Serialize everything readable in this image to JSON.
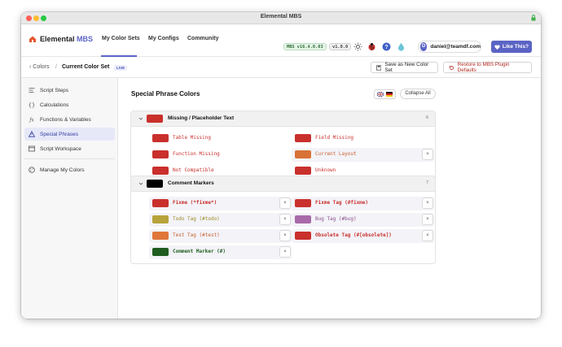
{
  "window": {
    "title": "Elemental MBS"
  },
  "brand": {
    "name": "Elemental",
    "suffix": "MBS"
  },
  "nav": {
    "tabs": [
      "My Color Sets",
      "My Configs",
      "Community"
    ]
  },
  "badges": {
    "mbs_version": "MBS v16.4.0.03",
    "app_version": "v1.0.0"
  },
  "user": {
    "initial": "D",
    "email": "daniel@teamdf.com"
  },
  "like_button": "Like This?",
  "breadcrumb": {
    "back": "Colors",
    "separator": "/",
    "current": "Current Color Set",
    "badge": "LIVE"
  },
  "actions": {
    "save_new": "Save as New Color Set",
    "restore": "Restore to MBS Plugin Defaults"
  },
  "sidebar": {
    "items": [
      "Script Steps",
      "Calculations",
      "Functions & Variables",
      "Special Phrases",
      "Script Workspace"
    ],
    "footer": "Manage My Colors",
    "active": "Special Phrases"
  },
  "page": {
    "title": "Special Phrase Colors",
    "collapse_all": "Collapse All"
  },
  "groups": [
    {
      "label": "Missing / Placeholder Text",
      "count": "6",
      "color": "#c9302c",
      "items": [
        {
          "text": "Table Missing",
          "color": "#c9302c",
          "text_color": "#c9302c",
          "bold": false,
          "removable": false
        },
        {
          "text": "Field Missing",
          "color": "#c9302c",
          "text_color": "#c9302c",
          "bold": false,
          "removable": false
        },
        {
          "text": "Function Missing",
          "color": "#c9302c",
          "text_color": "#c9302c",
          "bold": false,
          "removable": false
        },
        {
          "text": "Current Layout",
          "color": "#d87237",
          "text_color": "#c9602a",
          "bold": false,
          "removable": true
        },
        {
          "text": "Not Compatible",
          "color": "#c9302c",
          "text_color": "#c9302c",
          "bold": false,
          "removable": false
        },
        {
          "text": "Unknown",
          "color": "#c9302c",
          "text_color": "#c9302c",
          "bold": false,
          "removable": false
        }
      ]
    },
    {
      "label": "Comment Markers",
      "count": "7",
      "color": "#000000",
      "items": [
        {
          "text": "Fixme (*fixme*)",
          "color": "#c9302c",
          "text_color": "#c9302c",
          "bold": true,
          "removable": true
        },
        {
          "text": "Fixme Tag (#fixme)",
          "color": "#c9302c",
          "text_color": "#c9302c",
          "bold": true,
          "removable": true
        },
        {
          "text": "Todo Tag (#todo)",
          "color": "#b8a33a",
          "text_color": "#9d8a22",
          "bold": false,
          "removable": true
        },
        {
          "text": "Bug Tag (#bug)",
          "color": "#a86aa8",
          "text_color": "#8a4f8a",
          "bold": false,
          "removable": true
        },
        {
          "text": "Test Tag (#test)",
          "color": "#e0773a",
          "text_color": "#c9602a",
          "bold": false,
          "removable": true
        },
        {
          "text": "Obsolete Tag (#[obsolete])",
          "color": "#c9302c",
          "text_color": "#c9302c",
          "bold": true,
          "removable": true
        },
        {
          "text": "Comment Marker (#)",
          "color": "#1f5c1f",
          "text_color": "#1f5c1f",
          "bold": true,
          "removable": true
        }
      ]
    }
  ],
  "remove_symbol": "×",
  "icons": [
    "lock-icon",
    "house-icon",
    "sun-icon",
    "ladybug-icon",
    "help-icon",
    "drop-icon",
    "heart-icon",
    "restore-icon",
    "save-icon"
  ]
}
